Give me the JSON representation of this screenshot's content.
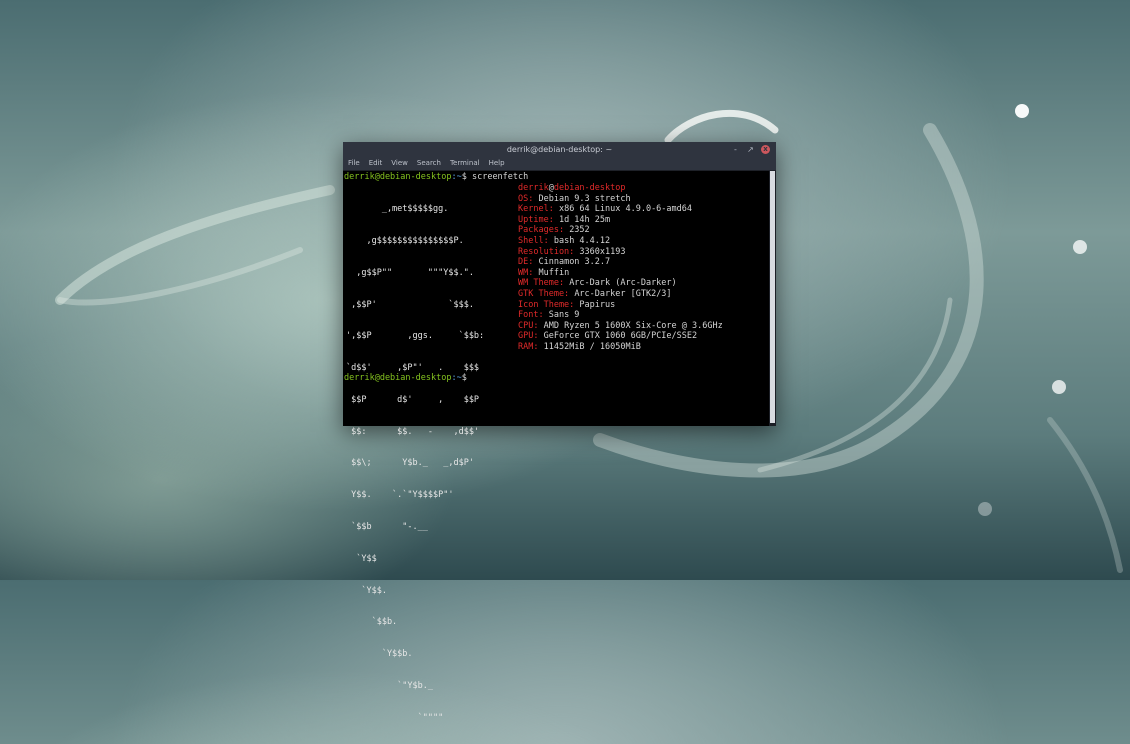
{
  "window": {
    "title": "derrik@debian-desktop: ~",
    "controls": {
      "minimize": "-",
      "maximize": "↗",
      "close": "x"
    }
  },
  "menu": [
    "File",
    "Edit",
    "View",
    "Search",
    "Terminal",
    "Help"
  ],
  "prompt": {
    "user_host": "derrik@debian-desktop",
    "path": ":~",
    "symbol": "$",
    "command": "screenfetch"
  },
  "logo_lines": [
    "       _,met$$$$$gg.",
    "    ,g$$$$$$$$$$$$$$$P.",
    "  ,g$$P\"\"       \"\"\"Y$$.\".",
    " ,$$P'              `$$$.",
    "',$$P       ,ggs.     `$$b:",
    "`d$$'     ,$P\"'   .    $$$",
    " $$P      d$'     ,    $$P",
    " $$:      $$.   -    ,d$$'",
    " $$\\;      Y$b._   _,d$P'",
    " Y$$.    `.`\"Y$$$$P\"'",
    " `$$b      \"-.__",
    "  `Y$$",
    "   `Y$$.",
    "     `$$b.",
    "       `Y$$b.",
    "          `\"Y$b._",
    "              `\"\"\"\""
  ],
  "header_user": "derrik",
  "header_host": "debian-desktop",
  "info": [
    {
      "key": "OS:",
      "value": "Debian 9.3 stretch"
    },
    {
      "key": "Kernel:",
      "value": "x86 64 Linux 4.9.0-6-amd64"
    },
    {
      "key": "Uptime:",
      "value": "1d 14h 25m"
    },
    {
      "key": "Packages:",
      "value": "2352"
    },
    {
      "key": "Shell:",
      "value": "bash 4.4.12"
    },
    {
      "key": "Resolution:",
      "value": "3360x1193"
    },
    {
      "key": "DE:",
      "value": "Cinnamon 3.2.7"
    },
    {
      "key": "WM:",
      "value": "Muffin"
    },
    {
      "key": "WM Theme:",
      "value": "Arc-Dark (Arc-Darker)"
    },
    {
      "key": "GTK Theme:",
      "value": "Arc-Darker [GTK2/3]"
    },
    {
      "key": "Icon Theme:",
      "value": "Papirus"
    },
    {
      "key": "Font:",
      "value": "Sans 9"
    },
    {
      "key": "CPU:",
      "value": "AMD Ryzen 5 1600X Six-Core @ 3.6GHz"
    },
    {
      "key": "GPU:",
      "value": "GeForce GTX 1060 6GB/PCIe/SSE2"
    },
    {
      "key": "RAM:",
      "value": "11452MiB / 16050MiB"
    }
  ],
  "colors": {
    "prompt_green": "#84c21f",
    "path_blue": "#5ea6e6",
    "info_red": "#e02a2a",
    "titlebar": "#2f343f"
  }
}
